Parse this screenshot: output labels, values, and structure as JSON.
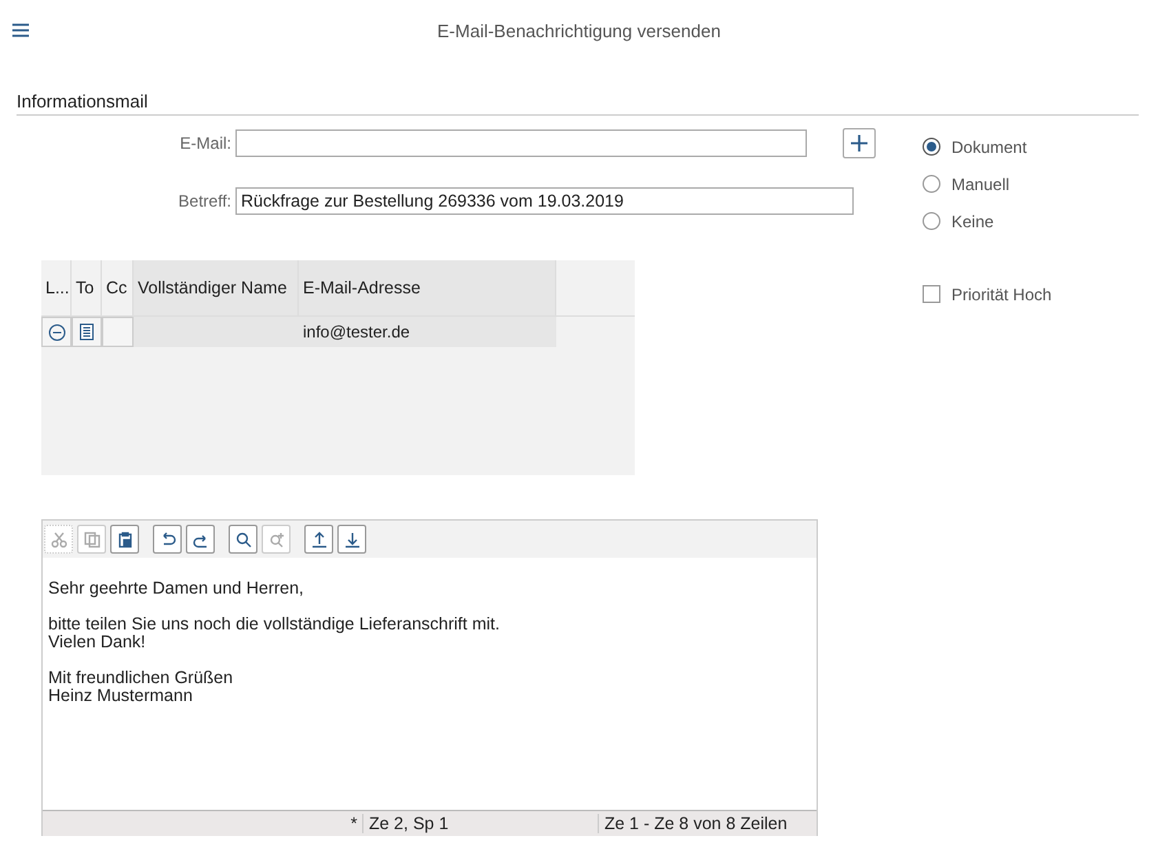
{
  "header": {
    "title": "E-Mail-Benachrichtigung versenden"
  },
  "section": {
    "title": "Informationsmail"
  },
  "email": {
    "label": "E-Mail:"
  },
  "subject": {
    "label": "Betreff:",
    "value": "Rückfrage zur Bestellung 269336 vom 19.03.2019"
  },
  "options": [
    {
      "label": "Dokument",
      "selected": true
    },
    {
      "label": "Manuell",
      "selected": false
    },
    {
      "label": "Keine",
      "selected": false
    }
  ],
  "priority": {
    "label": "Priorität Hoch",
    "checked": false
  },
  "table": {
    "columns": [
      "L...",
      "To",
      "Cc",
      "Vollständiger Name",
      "E-Mail-Adresse"
    ],
    "rows": [
      {
        "name": "",
        "email": "info@tester.de"
      }
    ]
  },
  "toolbar": [
    {
      "kind": "cut",
      "disabled": true
    },
    {
      "kind": "copy",
      "disabled": true
    },
    {
      "kind": "paste",
      "disabled": false
    },
    {
      "kind": "undo",
      "disabled": false
    },
    {
      "kind": "redo",
      "disabled": false
    },
    {
      "kind": "find",
      "disabled": false
    },
    {
      "kind": "findnext",
      "disabled": true
    },
    {
      "kind": "upload",
      "disabled": false
    },
    {
      "kind": "download",
      "disabled": false
    }
  ],
  "editor": {
    "paragraphs": [
      [
        "Sehr geehrte Damen und Herren,"
      ],
      [
        "bitte teilen Sie uns noch die vollständige Lieferanschrift mit.",
        "Vielen Dank!"
      ],
      [
        "Mit freundlichen Grüßen",
        "Heinz Mustermann"
      ]
    ]
  },
  "status_bar": {
    "modified": "*",
    "position": "Ze 2, Sp 1",
    "range": "Ze 1 - Ze 8 von 8 Zeilen"
  }
}
